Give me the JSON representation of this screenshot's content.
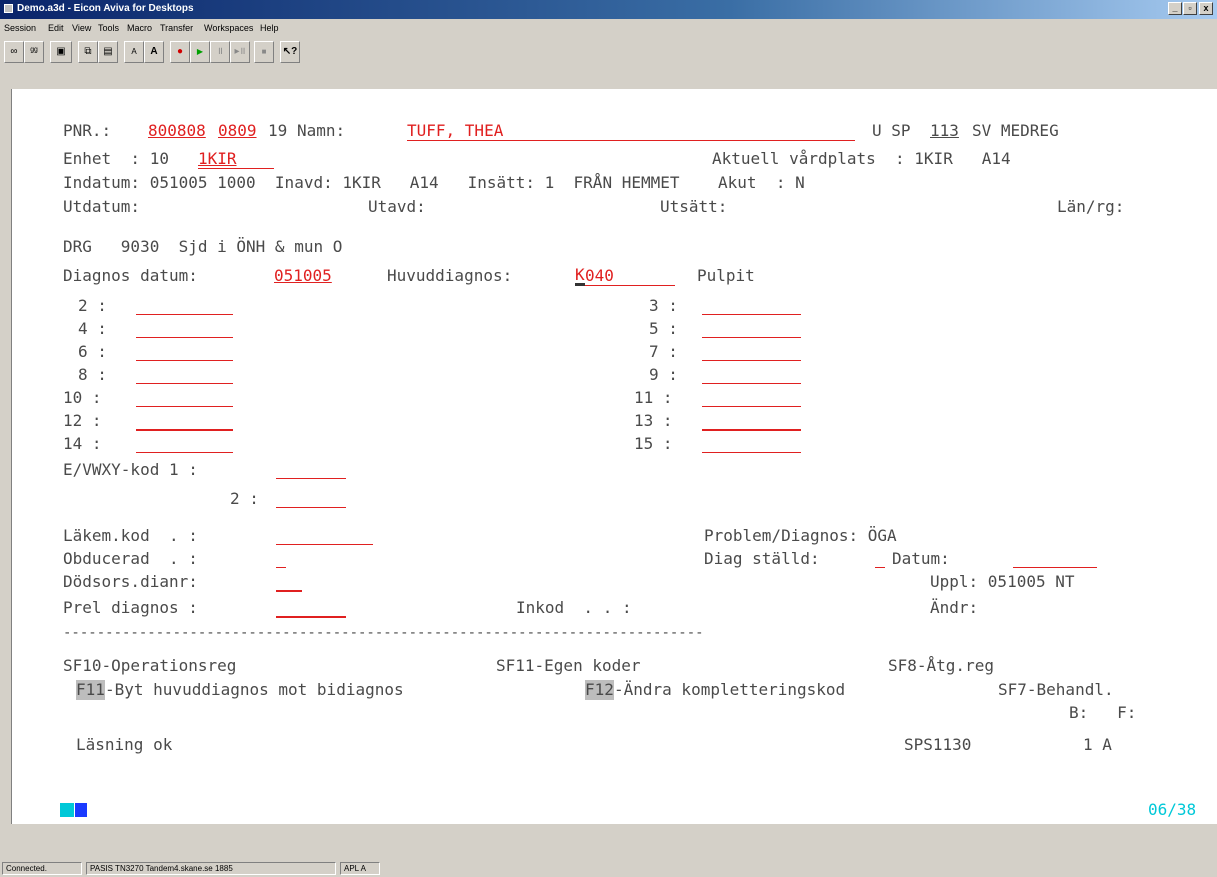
{
  "window": {
    "title": "Demo.a3d - Eicon Aviva for Desktops"
  },
  "menu": [
    "Session",
    "Edit",
    "View",
    "Tools",
    "Macro",
    "Transfer",
    "Workspaces",
    "Help"
  ],
  "screen": {
    "row1": {
      "pnr_label": "PNR.:",
      "pnr_date": "800808",
      "pnr_num": "0809",
      "century": "19",
      "name_label": "Namn:",
      "name": "TUFF, THEA",
      "code_prefix": "U SP",
      "code_num": "113",
      "code_suffix": "SV MEDREG"
    },
    "row2": {
      "enhet_label": "Enhet  : 10",
      "enhet_value": "1KIR",
      "aktuell_label": "Aktuell vårdplats  : 1KIR   A14"
    },
    "row3": {
      "indatum": "Indatum: 051005 1000  Inavd: 1KIR   A14   Insätt: 1  FRÅN HEMMET    Akut  : N"
    },
    "row4": {
      "utdatum": "Utdatum:",
      "utavd": "Utavd:",
      "utsatt": "Utsätt:",
      "lan": "Län/rg:"
    },
    "row5": {
      "drg": "DRG   9030  Sjd i ÖNH & mun O"
    },
    "row6": {
      "label": "Diagnos datum:",
      "date": "051005",
      "huvud_label": "Huvuddiagnos:",
      "cursor_char": "K",
      "code_rest": "040",
      "desc": "Pulpit"
    },
    "diag_left": [
      "2 :",
      "4 :",
      "6 :",
      "8 :",
      "10 :",
      "12 :",
      "14 :"
    ],
    "diag_right": [
      "3 :",
      "5 :",
      "7 :",
      "9 :",
      "11 :",
      "13 :",
      "15 :"
    ],
    "ewxy1": "E/VWXY-kod 1 :",
    "ewxy2": "2 :",
    "lakem": "Läkem.kod  . :",
    "problem": "Problem/Diagnos: ÖGA",
    "obducerad": "Obducerad  . :",
    "diag_stalld": "Diag ställd:",
    "datum": "Datum:",
    "dodsors": "Dödsors.dianr:",
    "uppl": "Uppl: 051005 NT",
    "prel": "Prel diagnos :",
    "inkod": "Inkod  . . :",
    "andr": "Ändr:",
    "separator": "----------------------------------------------------------------------------",
    "fkeys1": {
      "a": "SF10-Operationsreg",
      "b": "SF11-Egen koder",
      "c": "SF8-Åtg.reg"
    },
    "fkeys2": {
      "f11": "F11",
      "f11_text": "-Byt huvuddiagnos mot bidiagnos ",
      "f12": "F12",
      "f12_text": "-Ändra kompletteringskod",
      "sf7": "SF7-Behandl."
    },
    "bf": "B:   F:",
    "message": "Läsning ok",
    "program": "SPS1130",
    "page": "1 A"
  },
  "oia": {
    "position": "06/38"
  },
  "statusbar": [
    "Connected.",
    "PASIS  TN3270  Tandem4.skane.se  1885",
    "APL A"
  ],
  "colors": {
    "input_red": "#e02020",
    "text_gray": "#4a4a4a",
    "oia_cyan": "#00c8d8"
  }
}
